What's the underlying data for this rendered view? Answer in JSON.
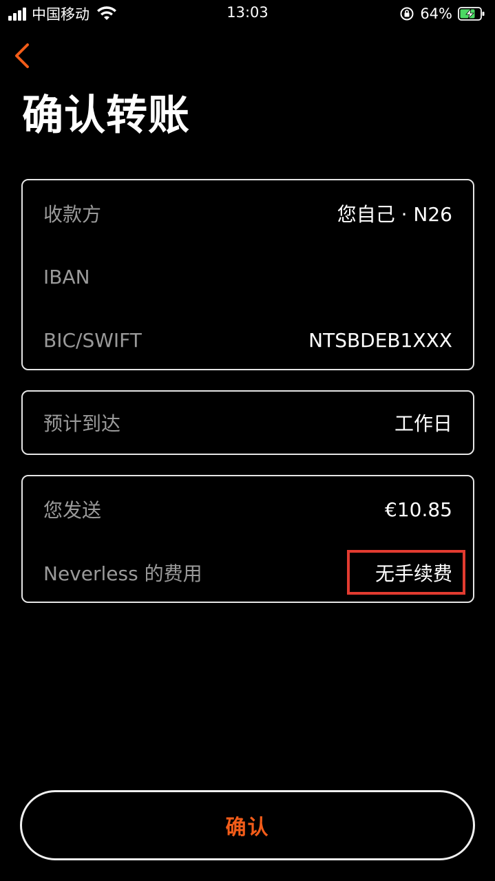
{
  "status_bar": {
    "carrier": "中国移动",
    "time": "13:03",
    "battery_percent": "64%",
    "icons": [
      "signal-icon",
      "wifi-icon",
      "orientation-lock-icon",
      "battery-charging-icon"
    ]
  },
  "header": {
    "back_icon": "chevron-left-icon",
    "title": "确认转账"
  },
  "recipient_card": {
    "payee_label": "收款方",
    "payee_value": "您自己 · N26",
    "iban_label": "IBAN",
    "iban_value": "",
    "bic_label": "BIC/SWIFT",
    "bic_value": "NTSBDEB1XXX"
  },
  "arrival_card": {
    "label": "预计到达",
    "value": "工作日"
  },
  "amount_card": {
    "send_label": "您发送",
    "send_value": "€10.85",
    "fee_label": "Neverless 的费用",
    "fee_value": "无手续费"
  },
  "confirm_button": {
    "label": "确认"
  },
  "colors": {
    "background": "#000000",
    "accent": "#f25c19",
    "highlight": "#e23b30",
    "label": "#9a9a9a",
    "value": "#ffffff"
  }
}
